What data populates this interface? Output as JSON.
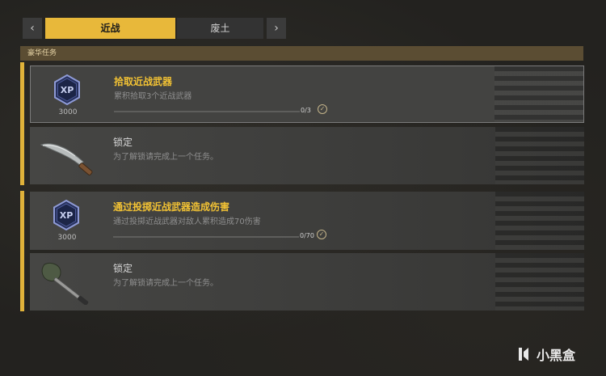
{
  "tabs": {
    "prev_icon": "chevron-left-icon",
    "next_icon": "chevron-right-icon",
    "items": [
      {
        "label": "近战",
        "active": true
      },
      {
        "label": "废土",
        "active": false
      }
    ],
    "accent_color": "#e8b83a"
  },
  "section": {
    "header": "豪华任务"
  },
  "tasks": [
    {
      "title": "拾取近战武器",
      "description": "累积拾取3个近战武器",
      "reward_icon": "xp-badge-icon",
      "reward_amount": "3000",
      "progress_text": "0/3",
      "progress_value": 0,
      "status_icon": "check-circle-icon"
    },
    {
      "title": "锁定",
      "description": "为了解锁请完成上一个任务。",
      "reward_icon": "machete-icon"
    },
    {
      "title": "通过投掷近战武器造成伤害",
      "description": "通过投掷近战武器对敌人累积造成70伤害",
      "reward_icon": "xp-badge-icon",
      "reward_amount": "3000",
      "progress_text": "0/70",
      "progress_value": 0,
      "status_icon": "check-circle-icon"
    },
    {
      "title": "锁定",
      "description": "为了解锁请完成上一个任务。",
      "reward_icon": "shovel-icon"
    }
  ],
  "watermark": {
    "text": "小黑盒",
    "icon": "heybox-logo-icon"
  }
}
